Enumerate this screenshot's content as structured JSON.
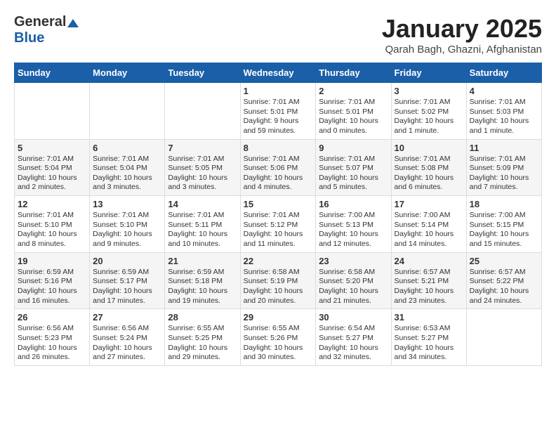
{
  "header": {
    "logo_general": "General",
    "logo_blue": "Blue",
    "month_title": "January 2025",
    "location": "Qarah Bagh, Ghazni, Afghanistan"
  },
  "weekdays": [
    "Sunday",
    "Monday",
    "Tuesday",
    "Wednesday",
    "Thursday",
    "Friday",
    "Saturday"
  ],
  "weeks": [
    [
      {
        "day": "",
        "info": ""
      },
      {
        "day": "",
        "info": ""
      },
      {
        "day": "",
        "info": ""
      },
      {
        "day": "1",
        "info": "Sunrise: 7:01 AM\nSunset: 5:01 PM\nDaylight: 9 hours and 59 minutes."
      },
      {
        "day": "2",
        "info": "Sunrise: 7:01 AM\nSunset: 5:01 PM\nDaylight: 10 hours and 0 minutes."
      },
      {
        "day": "3",
        "info": "Sunrise: 7:01 AM\nSunset: 5:02 PM\nDaylight: 10 hours and 1 minute."
      },
      {
        "day": "4",
        "info": "Sunrise: 7:01 AM\nSunset: 5:03 PM\nDaylight: 10 hours and 1 minute."
      }
    ],
    [
      {
        "day": "5",
        "info": "Sunrise: 7:01 AM\nSunset: 5:04 PM\nDaylight: 10 hours and 2 minutes."
      },
      {
        "day": "6",
        "info": "Sunrise: 7:01 AM\nSunset: 5:04 PM\nDaylight: 10 hours and 3 minutes."
      },
      {
        "day": "7",
        "info": "Sunrise: 7:01 AM\nSunset: 5:05 PM\nDaylight: 10 hours and 3 minutes."
      },
      {
        "day": "8",
        "info": "Sunrise: 7:01 AM\nSunset: 5:06 PM\nDaylight: 10 hours and 4 minutes."
      },
      {
        "day": "9",
        "info": "Sunrise: 7:01 AM\nSunset: 5:07 PM\nDaylight: 10 hours and 5 minutes."
      },
      {
        "day": "10",
        "info": "Sunrise: 7:01 AM\nSunset: 5:08 PM\nDaylight: 10 hours and 6 minutes."
      },
      {
        "day": "11",
        "info": "Sunrise: 7:01 AM\nSunset: 5:09 PM\nDaylight: 10 hours and 7 minutes."
      }
    ],
    [
      {
        "day": "12",
        "info": "Sunrise: 7:01 AM\nSunset: 5:10 PM\nDaylight: 10 hours and 8 minutes."
      },
      {
        "day": "13",
        "info": "Sunrise: 7:01 AM\nSunset: 5:10 PM\nDaylight: 10 hours and 9 minutes."
      },
      {
        "day": "14",
        "info": "Sunrise: 7:01 AM\nSunset: 5:11 PM\nDaylight: 10 hours and 10 minutes."
      },
      {
        "day": "15",
        "info": "Sunrise: 7:01 AM\nSunset: 5:12 PM\nDaylight: 10 hours and 11 minutes."
      },
      {
        "day": "16",
        "info": "Sunrise: 7:00 AM\nSunset: 5:13 PM\nDaylight: 10 hours and 12 minutes."
      },
      {
        "day": "17",
        "info": "Sunrise: 7:00 AM\nSunset: 5:14 PM\nDaylight: 10 hours and 14 minutes."
      },
      {
        "day": "18",
        "info": "Sunrise: 7:00 AM\nSunset: 5:15 PM\nDaylight: 10 hours and 15 minutes."
      }
    ],
    [
      {
        "day": "19",
        "info": "Sunrise: 6:59 AM\nSunset: 5:16 PM\nDaylight: 10 hours and 16 minutes."
      },
      {
        "day": "20",
        "info": "Sunrise: 6:59 AM\nSunset: 5:17 PM\nDaylight: 10 hours and 17 minutes."
      },
      {
        "day": "21",
        "info": "Sunrise: 6:59 AM\nSunset: 5:18 PM\nDaylight: 10 hours and 19 minutes."
      },
      {
        "day": "22",
        "info": "Sunrise: 6:58 AM\nSunset: 5:19 PM\nDaylight: 10 hours and 20 minutes."
      },
      {
        "day": "23",
        "info": "Sunrise: 6:58 AM\nSunset: 5:20 PM\nDaylight: 10 hours and 21 minutes."
      },
      {
        "day": "24",
        "info": "Sunrise: 6:57 AM\nSunset: 5:21 PM\nDaylight: 10 hours and 23 minutes."
      },
      {
        "day": "25",
        "info": "Sunrise: 6:57 AM\nSunset: 5:22 PM\nDaylight: 10 hours and 24 minutes."
      }
    ],
    [
      {
        "day": "26",
        "info": "Sunrise: 6:56 AM\nSunset: 5:23 PM\nDaylight: 10 hours and 26 minutes."
      },
      {
        "day": "27",
        "info": "Sunrise: 6:56 AM\nSunset: 5:24 PM\nDaylight: 10 hours and 27 minutes."
      },
      {
        "day": "28",
        "info": "Sunrise: 6:55 AM\nSunset: 5:25 PM\nDaylight: 10 hours and 29 minutes."
      },
      {
        "day": "29",
        "info": "Sunrise: 6:55 AM\nSunset: 5:26 PM\nDaylight: 10 hours and 30 minutes."
      },
      {
        "day": "30",
        "info": "Sunrise: 6:54 AM\nSunset: 5:27 PM\nDaylight: 10 hours and 32 minutes."
      },
      {
        "day": "31",
        "info": "Sunrise: 6:53 AM\nSunset: 5:27 PM\nDaylight: 10 hours and 34 minutes."
      },
      {
        "day": "",
        "info": ""
      }
    ]
  ]
}
